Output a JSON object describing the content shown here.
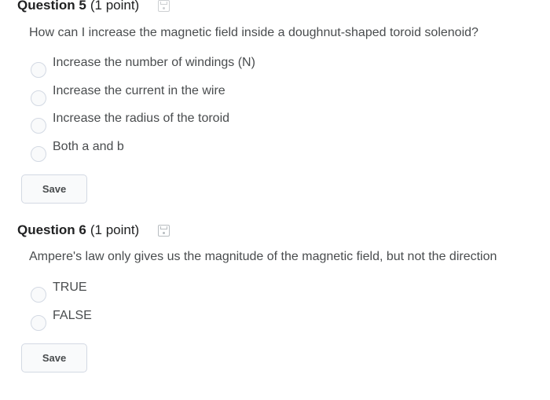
{
  "questions": [
    {
      "title": "Question 5",
      "points": "(1 point)",
      "icon": "save-icon",
      "text": "How can I increase the magnetic field inside a doughnut-shaped toroid solenoid?",
      "options": [
        "Increase the number of windings (N)",
        "Increase the current in the wire",
        "Increase the radius of the toroid",
        "Both a and b"
      ],
      "save_label": "Save"
    },
    {
      "title": "Question 6",
      "points": "(1 point)",
      "icon": "save-icon",
      "text": "Ampere's law only gives us the magnitude of the magnetic field, but not the direction",
      "options": [
        "TRUE",
        "FALSE"
      ],
      "save_label": "Save"
    }
  ],
  "colors": {
    "text": "#494c4e",
    "heading": "#202122",
    "border": "#d3d9e3",
    "background": "#ffffff"
  }
}
